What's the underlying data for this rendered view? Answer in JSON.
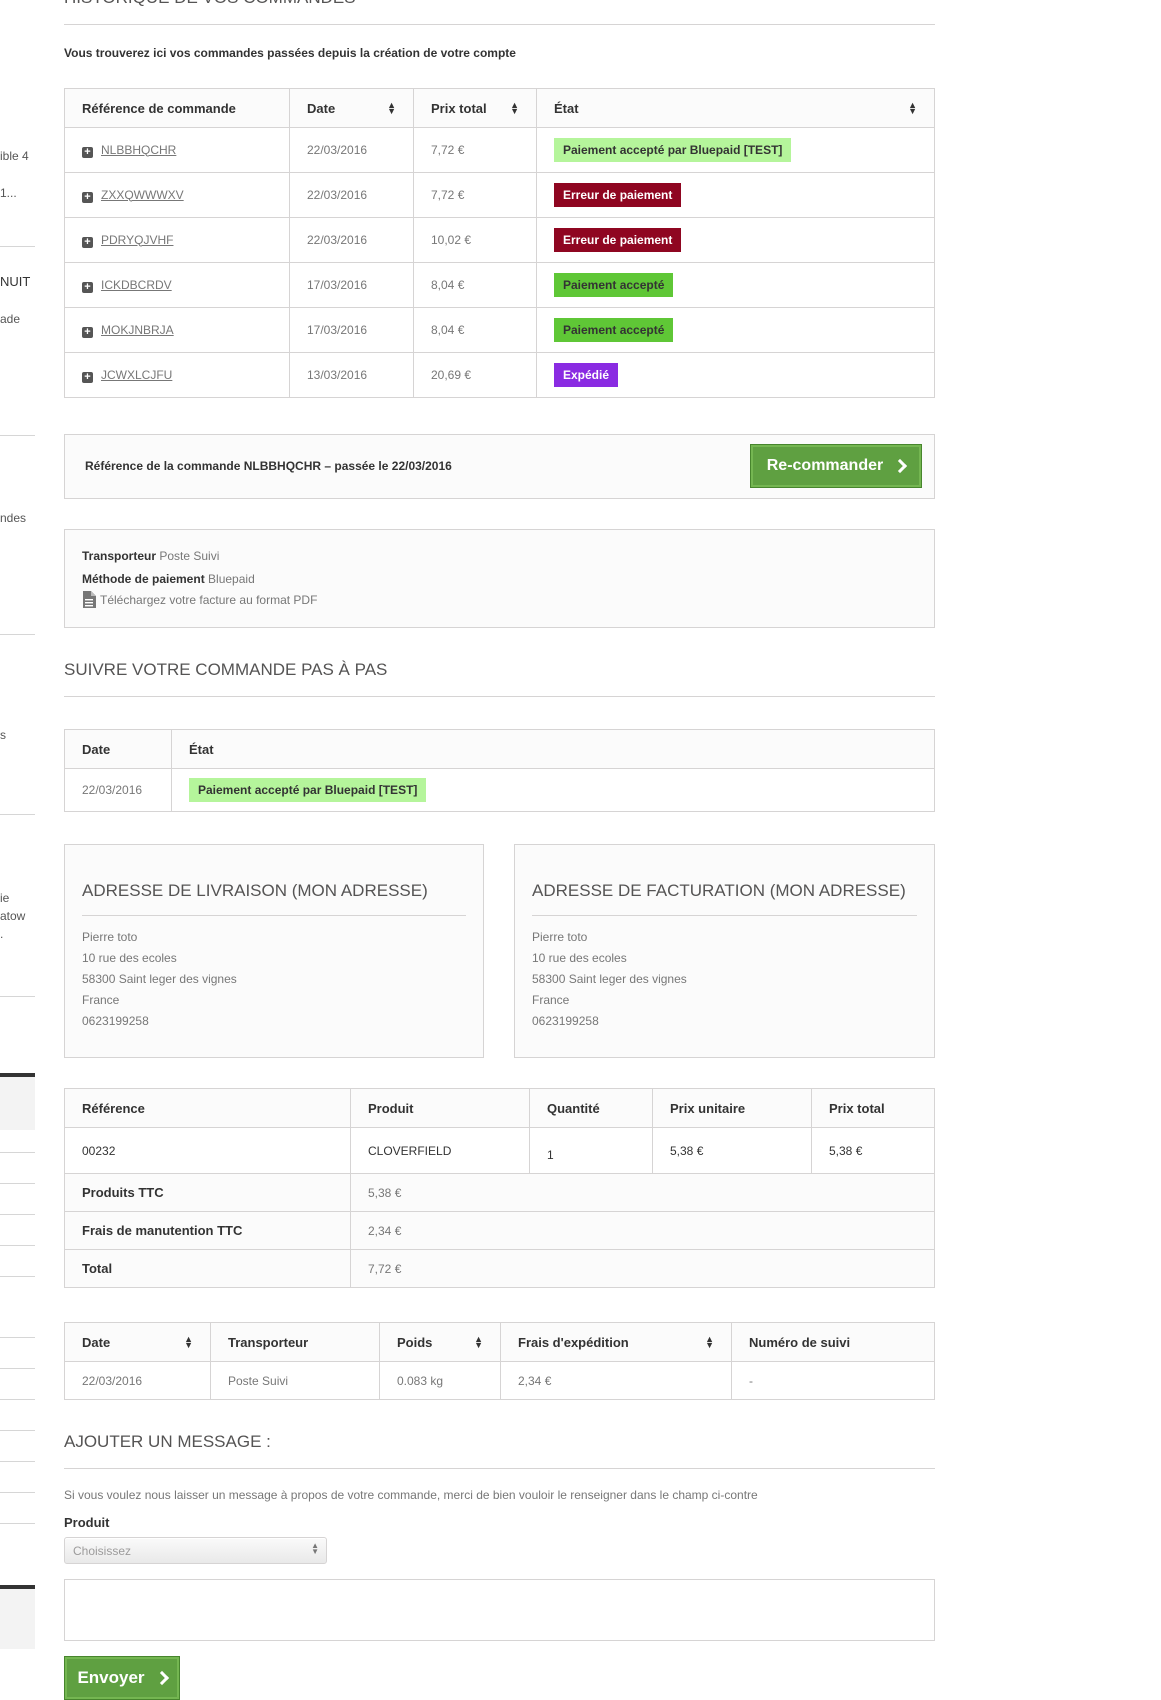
{
  "sidebar": {
    "fragments": [
      "ible 4",
      "1...",
      "NUIT",
      "ade",
      "ndes",
      "s",
      "ie",
      "atow",
      "."
    ]
  },
  "history": {
    "title": "Historique de vos commandes",
    "intro": "Vous trouverez ici vos commandes passées depuis la création de votre compte",
    "columns": [
      "Référence de commande",
      "Date",
      "Prix total",
      "État"
    ],
    "orders": [
      {
        "ref": "NLBBHQCHR",
        "date": "22/03/2016",
        "total": "7,72 €",
        "status": "Paiement accepté par Bluepaid [TEST]",
        "status_color": "#b5f59b",
        "status_text_color": "#333333"
      },
      {
        "ref": "ZXXQWWWXV",
        "date": "22/03/2016",
        "total": "7,72 €",
        "status": "Erreur de paiement",
        "status_color": "#8f0621",
        "status_text_color": "#ffffff"
      },
      {
        "ref": "PDRYQJVHF",
        "date": "22/03/2016",
        "total": "10,02 €",
        "status": "Erreur de paiement",
        "status_color": "#8f0621",
        "status_text_color": "#ffffff"
      },
      {
        "ref": "ICKDBCRDV",
        "date": "17/03/2016",
        "total": "8,04 €",
        "status": "Paiement accepté",
        "status_color": "#5fc736",
        "status_text_color": "#333333"
      },
      {
        "ref": "MOKJNBRJA",
        "date": "17/03/2016",
        "total": "8,04 €",
        "status": "Paiement accepté",
        "status_color": "#5fc736",
        "status_text_color": "#333333"
      },
      {
        "ref": "JCWXLCJFU",
        "date": "13/03/2016",
        "total": "20,69 €",
        "status": "Expédié",
        "status_color": "#8a2be2",
        "status_text_color": "#ffffff"
      }
    ]
  },
  "order_info": {
    "heading": "Référence de la commande NLBBHQCHR – passée le 22/03/2016",
    "reorder_label": "Re-commander"
  },
  "shipping_info": {
    "carrier_label": "Transporteur",
    "carrier_value": "Poste Suivi",
    "payment_label": "Méthode de paiement",
    "payment_value": "Bluepaid",
    "invoice_label": "Téléchargez votre facture au format PDF"
  },
  "follow": {
    "title": "Suivre votre commande pas à pas",
    "columns": [
      "Date",
      "État"
    ],
    "rows": [
      {
        "date": "22/03/2016",
        "status": "Paiement accepté par Bluepaid [TEST]",
        "status_color": "#b5f59b"
      }
    ]
  },
  "delivery_address": {
    "title": "Adresse de livraison (Mon adresse)",
    "lines": [
      "Pierre toto",
      "10 rue des ecoles",
      "58300 Saint leger des vignes",
      "France",
      "0623199258"
    ]
  },
  "invoice_address": {
    "title": "Adresse de facturation (Mon adresse)",
    "lines": [
      "Pierre toto",
      "10 rue des ecoles",
      "58300 Saint leger des vignes",
      "France",
      "0623199258"
    ]
  },
  "products": {
    "columns": [
      "Référence",
      "Produit",
      "Quantité",
      "Prix unitaire",
      "Prix total"
    ],
    "items": [
      {
        "ref": "00232",
        "name": "CLOVERFIELD",
        "qty": "1",
        "unit": "5,38 €",
        "total": "5,38 €"
      }
    ],
    "totals": [
      {
        "label": "Produits TTC",
        "value": "5,38 €"
      },
      {
        "label": "Frais de manutention TTC",
        "value": "2,34 €"
      },
      {
        "label": "Total",
        "value": "7,72 €"
      }
    ]
  },
  "shipping": {
    "columns": [
      "Date",
      "Transporteur",
      "Poids",
      "Frais d'expédition",
      "Numéro de suivi"
    ],
    "rows": [
      {
        "date": "22/03/2016",
        "carrier": "Poste Suivi",
        "weight": "0.083 kg",
        "fee": "2,34 €",
        "tracking": "-"
      }
    ]
  },
  "message": {
    "title": "Ajouter un message :",
    "intro": "Si vous voulez nous laisser un message à propos de votre commande, merci de bien vouloir le renseigner dans le champ ci-contre",
    "product_label": "Produit",
    "select_value": "Choisissez",
    "send_label": "Envoyer"
  },
  "colors": {
    "accent_green": "#5fa041",
    "border": "#d6d4d4"
  }
}
